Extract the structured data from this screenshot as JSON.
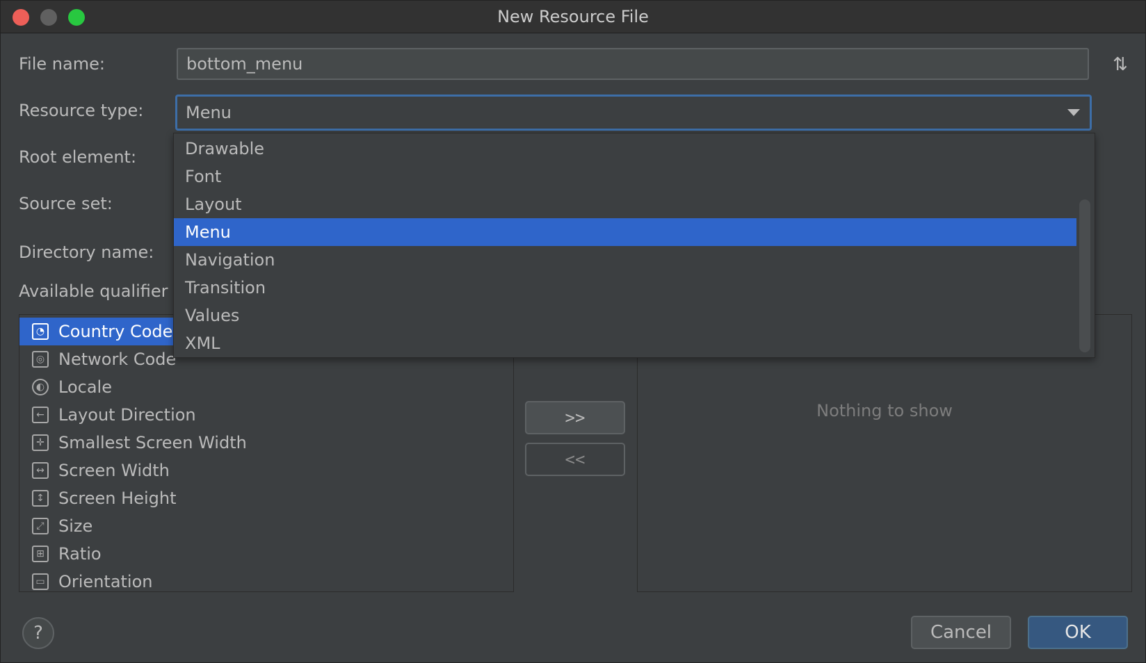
{
  "window": {
    "title": "New Resource File"
  },
  "form": {
    "file_name_label": "File name:",
    "file_name_value": "bottom_menu",
    "resource_type_label": "Resource type:",
    "resource_type_value": "Menu",
    "root_element_label": "Root element:",
    "source_set_label": "Source set:",
    "directory_name_label": "Directory name:",
    "available_qualifiers_label": "Available qualifier"
  },
  "dropdown": {
    "items": [
      "Drawable",
      "Font",
      "Layout",
      "Menu",
      "Navigation",
      "Transition",
      "Values",
      "XML"
    ],
    "selected": "Menu"
  },
  "qualifiers": {
    "items": [
      {
        "label": "Country Code",
        "icon": "country-code-icon"
      },
      {
        "label": "Network Code",
        "icon": "network-code-icon"
      },
      {
        "label": "Locale",
        "icon": "globe-icon"
      },
      {
        "label": "Layout Direction",
        "icon": "layout-direction-icon"
      },
      {
        "label": "Smallest Screen Width",
        "icon": "smallest-width-icon"
      },
      {
        "label": "Screen Width",
        "icon": "screen-width-icon"
      },
      {
        "label": "Screen Height",
        "icon": "screen-height-icon"
      },
      {
        "label": "Size",
        "icon": "size-icon"
      },
      {
        "label": "Ratio",
        "icon": "ratio-icon"
      },
      {
        "label": "Orientation",
        "icon": "orientation-icon"
      }
    ],
    "selected": "Country Code"
  },
  "buttons": {
    "add": ">>",
    "remove": "<<",
    "cancel": "Cancel",
    "ok": "OK",
    "help": "?"
  },
  "chosen_panel": {
    "empty_text": "Nothing to show"
  },
  "colors": {
    "accent": "#2f65ca",
    "focus_border": "#3d6ea8",
    "background": "#3c3f41",
    "ok_button": "#365880"
  }
}
